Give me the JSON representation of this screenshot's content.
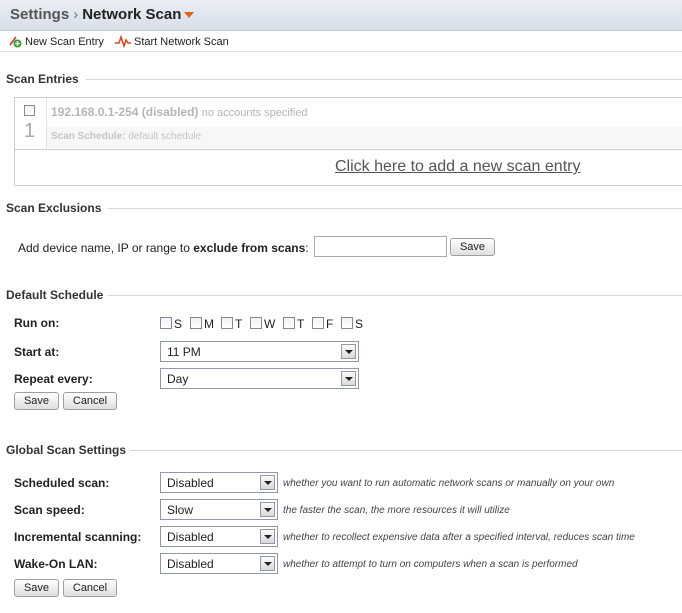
{
  "breadcrumb": {
    "parent": "Settings",
    "separator": "›",
    "current": "Network Scan"
  },
  "toolbar": {
    "new_entry": "New Scan Entry",
    "start_scan": "Start Network Scan"
  },
  "scan_entries": {
    "heading": "Scan Entries",
    "items": [
      {
        "number": "1",
        "range": "192.168.0.1-254 (disabled)",
        "accounts": "no accounts specified",
        "schedule_label": "Scan Schedule:",
        "schedule_value": "default schedule"
      }
    ],
    "add_link": "Click here to add a new scan entry"
  },
  "scan_exclusions": {
    "heading": "Scan Exclusions",
    "label_prefix": "Add device name, IP or range to ",
    "label_bold": "exclude from scans",
    "label_suffix": ":",
    "input_value": "",
    "save": "Save"
  },
  "default_schedule": {
    "heading": "Default Schedule",
    "run_on_label": "Run on:",
    "days": [
      "S",
      "M",
      "T",
      "W",
      "T",
      "F",
      "S"
    ],
    "start_label": "Start at:",
    "start_value": "11 PM",
    "repeat_label": "Repeat every:",
    "repeat_value": "Day",
    "save": "Save",
    "cancel": "Cancel"
  },
  "global_settings": {
    "heading": "Global Scan Settings",
    "rows": [
      {
        "label": "Scheduled scan:",
        "value": "Disabled",
        "hint": "whether you want to run automatic network scans or manually on your own"
      },
      {
        "label": "Scan speed:",
        "value": "Slow",
        "hint": "the faster the scan, the more resources it will utilize"
      },
      {
        "label": "Incremental scanning:",
        "value": "Disabled",
        "hint": "whether to recollect expensive data after a specified interval, reduces scan time"
      },
      {
        "label": "Wake-On LAN:",
        "value": "Disabled",
        "hint": "whether to attempt to turn on computers when a scan is performed"
      }
    ],
    "save": "Save",
    "cancel": "Cancel"
  },
  "icons": {
    "new_entry": "add-icon",
    "start_scan": "pulse-icon",
    "title_menu": "caret-down-icon"
  },
  "colors": {
    "accent": "#e0601a",
    "titlebar": "#dde4ec"
  }
}
